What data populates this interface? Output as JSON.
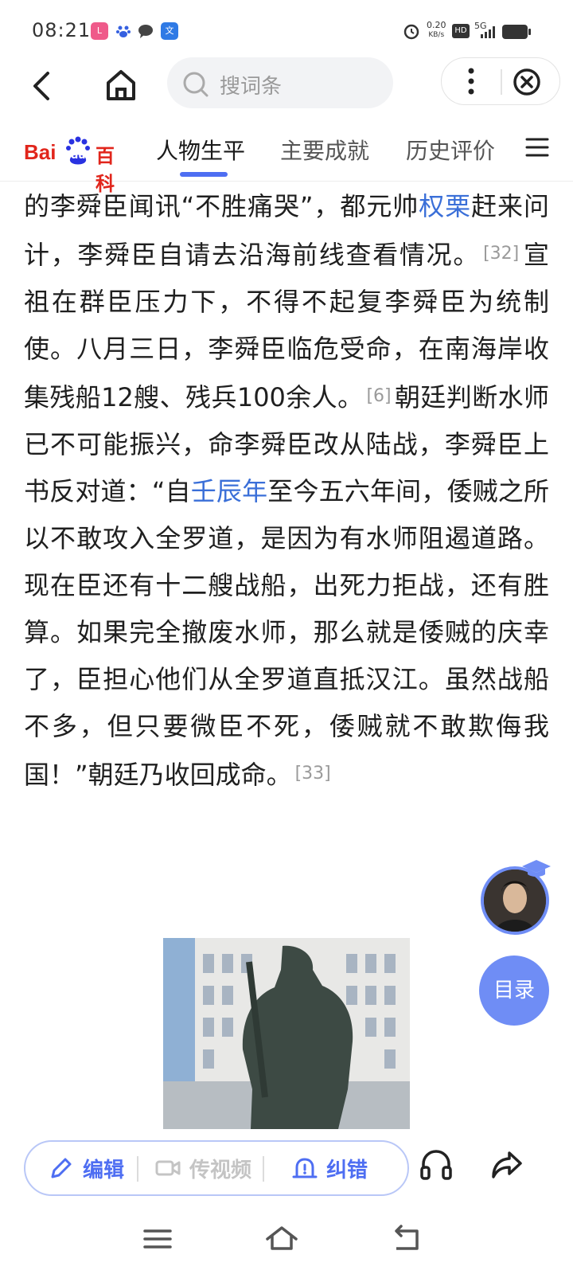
{
  "status_bar": {
    "time": "08:21",
    "net_speed_value": "0.20",
    "net_speed_unit": "KB/s",
    "hd": "HD",
    "network": "5G",
    "app_icons": [
      "lofter-icon",
      "baidu-paw-icon",
      "chat-icon",
      "translate-icon"
    ]
  },
  "top_nav": {
    "search_placeholder": "搜词条"
  },
  "logo": {
    "text_left": "Bai",
    "text_paw": "du",
    "text_right": "百科"
  },
  "tabs": [
    {
      "label": "人物生平",
      "active": true
    },
    {
      "label": "主要成就",
      "active": false
    },
    {
      "label": "历史评价",
      "active": false
    }
  ],
  "article": {
    "p1_a": "的李舜臣闻讯“不胜痛哭”，都元帅",
    "p1_link": "权栗",
    "p1_b": "赶来问计，李舜臣自请去沿海前线查看情况。",
    "ref1": "[32]",
    "p1_c": "宣祖在群臣压力下，不得不起复李舜臣为统制使。八月三日，李舜臣临危受命，在南海岸收集残船12艘、残兵100余人。",
    "ref2": "[6]",
    "p1_d": "朝廷判断水师已不可能振兴，命李舜臣改从陆战，李舜臣上书反对道：“自",
    "p1_link2": "壬辰年",
    "p1_e": "至今五六年间，倭贼之所以不敢攻入全罗道，是因为有水师阻遏道路。现在臣还有十二艘战船，出死力拒战，还有胜算。如果完全撤废水师，那么就是倭贼的庆幸了，臣担心他们从全罗道直抵汉江。虽然战船不多，但只要微臣不死，倭贼就不敢欺侮我国！”朝廷乃收回成命。",
    "ref3": "[33]"
  },
  "floating": {
    "toc_label": "目录"
  },
  "toolbar": {
    "edit_label": "编辑",
    "video_label": "传视频",
    "correct_label": "纠错"
  },
  "colors": {
    "accent": "#4e6ef2",
    "link": "#3a6fd8",
    "baidu_red": "#e1251b",
    "baidu_blue": "#2932e1"
  }
}
